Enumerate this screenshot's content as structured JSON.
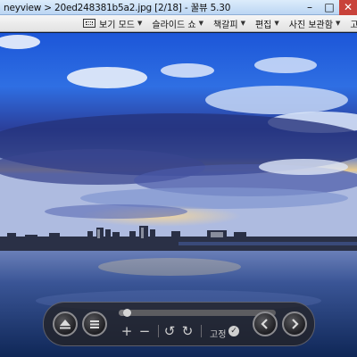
{
  "window": {
    "title": "neyview > 20ed248381b5a2.jpg [2/18] - 꿀뷰 5.30",
    "minimize_glyph": "–",
    "maximize_glyph": "□",
    "close_glyph": "✕"
  },
  "menu": {
    "items": [
      {
        "label": "보기 모드",
        "icon": "view-mode-icon"
      },
      {
        "label": "슬라이드 쇼"
      },
      {
        "label": "책갈피"
      },
      {
        "label": "편집"
      },
      {
        "label": "사진 보관함"
      },
      {
        "label": "고"
      }
    ]
  },
  "viewer": {
    "image_description": "city skyline at dusk across a river under a blue cloudy sky"
  },
  "controls": {
    "eject_icon": "eject-icon",
    "menu_icon": "menu-list-icon",
    "zoom_in": "+",
    "zoom_out": "−",
    "rotate_left": "↺",
    "rotate_right": "↻",
    "fix_label": "고정",
    "fix_checked": true,
    "prev_icon": "chevron-left-icon",
    "next_icon": "chevron-right-icon",
    "slider_position": 0.03
  }
}
